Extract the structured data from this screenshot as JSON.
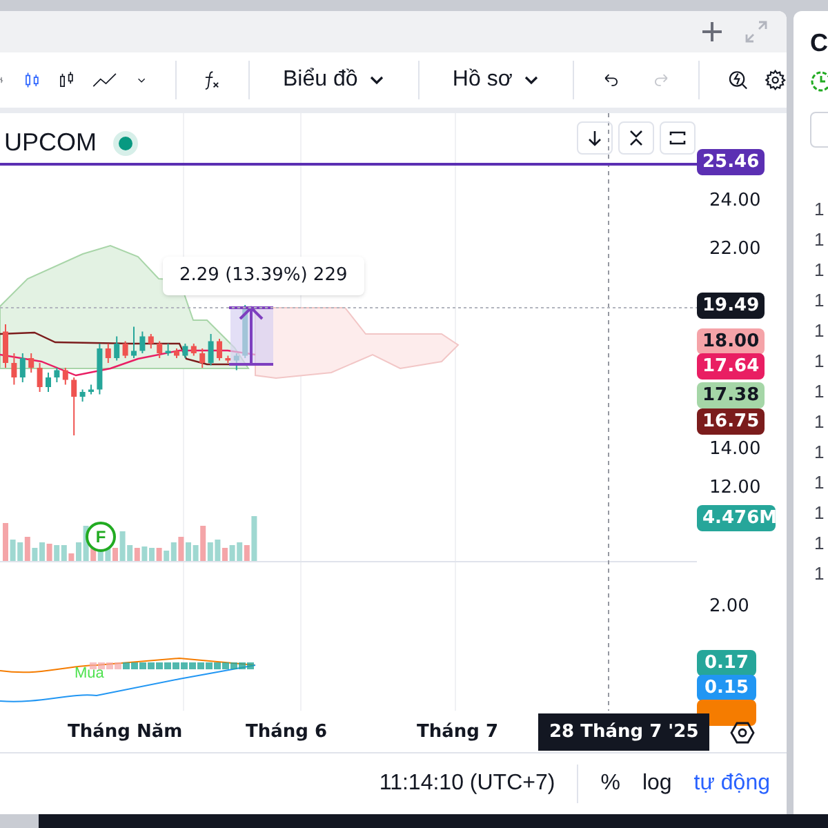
{
  "toolbar": {
    "chart_types": [
      {
        "kind": "bars",
        "selected": false
      },
      {
        "kind": "candles",
        "selected": true
      },
      {
        "kind": "hollow",
        "selected": false
      },
      {
        "kind": "line",
        "selected": false
      }
    ],
    "menus": [
      "Biểu đồ",
      "Hồ sơ"
    ],
    "undo": {
      "disabled": false
    },
    "redo": {
      "disabled": true
    }
  },
  "legend": {
    "symbol": "UPCOM",
    "live": true
  },
  "measurement": "2.29 (13.39%) 229",
  "price_axis": {
    "ticks": [
      "24.00",
      "22.00",
      "14.00",
      "12.00",
      "2.00"
    ],
    "tags": [
      {
        "text": "25.46",
        "color": "#5b2fb3"
      },
      {
        "text": "19.49",
        "color": "#131722"
      },
      {
        "text": "18.00",
        "color": "#f5a3a8"
      },
      {
        "text": "17.64",
        "color": "#e91e63"
      },
      {
        "text": "17.38",
        "color": "#a5d6a7"
      },
      {
        "text": "16.75",
        "color": "#7b1c1c"
      },
      {
        "text": "4.476M",
        "color": "#26a69a"
      },
      {
        "text": "0.17",
        "color": "#26a69a"
      },
      {
        "text": "0.15",
        "color": "#2196f3"
      },
      {
        "color": "#f57c00"
      }
    ]
  },
  "event_marker": "F",
  "signal": "Mua",
  "time_axis": {
    "labels": [
      "Tháng Năm",
      "Tháng 6",
      "Tháng 7"
    ],
    "crosshair_label": "28 Tháng 7 '25"
  },
  "footer": {
    "time": "11:14:10 (UTC+7)",
    "scale_buttons": [
      {
        "label": "%",
        "selected": false
      },
      {
        "label": "log",
        "selected": false
      },
      {
        "label": "tự động",
        "selected": true
      }
    ]
  },
  "side_panel": {
    "title": "C",
    "values": [
      "1",
      "1",
      "1",
      "1",
      "1",
      "1",
      "1",
      "1",
      "1",
      "1",
      "1",
      "1",
      "1"
    ]
  }
}
